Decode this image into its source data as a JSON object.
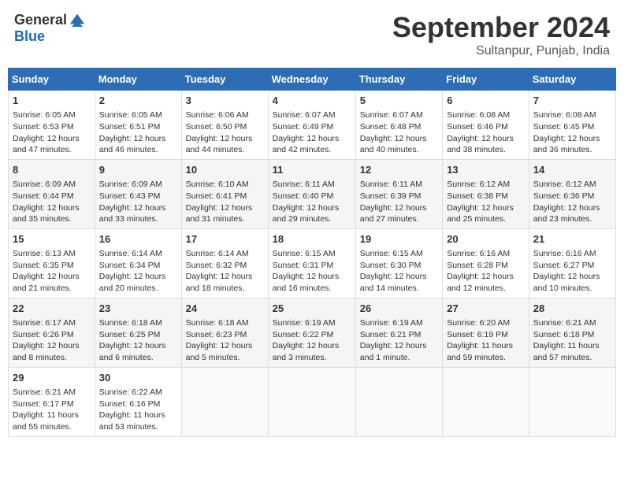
{
  "header": {
    "logo_general": "General",
    "logo_blue": "Blue",
    "month_title": "September 2024",
    "location": "Sultanpur, Punjab, India"
  },
  "days_of_week": [
    "Sunday",
    "Monday",
    "Tuesday",
    "Wednesday",
    "Thursday",
    "Friday",
    "Saturday"
  ],
  "weeks": [
    [
      {
        "day": 1,
        "sunrise": "6:05 AM",
        "sunset": "6:53 PM",
        "daylight": "12 hours and 47 minutes."
      },
      {
        "day": 2,
        "sunrise": "6:05 AM",
        "sunset": "6:51 PM",
        "daylight": "12 hours and 46 minutes."
      },
      {
        "day": 3,
        "sunrise": "6:06 AM",
        "sunset": "6:50 PM",
        "daylight": "12 hours and 44 minutes."
      },
      {
        "day": 4,
        "sunrise": "6:07 AM",
        "sunset": "6:49 PM",
        "daylight": "12 hours and 42 minutes."
      },
      {
        "day": 5,
        "sunrise": "6:07 AM",
        "sunset": "6:48 PM",
        "daylight": "12 hours and 40 minutes."
      },
      {
        "day": 6,
        "sunrise": "6:08 AM",
        "sunset": "6:46 PM",
        "daylight": "12 hours and 38 minutes."
      },
      {
        "day": 7,
        "sunrise": "6:08 AM",
        "sunset": "6:45 PM",
        "daylight": "12 hours and 36 minutes."
      }
    ],
    [
      {
        "day": 8,
        "sunrise": "6:09 AM",
        "sunset": "6:44 PM",
        "daylight": "12 hours and 35 minutes."
      },
      {
        "day": 9,
        "sunrise": "6:09 AM",
        "sunset": "6:43 PM",
        "daylight": "12 hours and 33 minutes."
      },
      {
        "day": 10,
        "sunrise": "6:10 AM",
        "sunset": "6:41 PM",
        "daylight": "12 hours and 31 minutes."
      },
      {
        "day": 11,
        "sunrise": "6:11 AM",
        "sunset": "6:40 PM",
        "daylight": "12 hours and 29 minutes."
      },
      {
        "day": 12,
        "sunrise": "6:11 AM",
        "sunset": "6:39 PM",
        "daylight": "12 hours and 27 minutes."
      },
      {
        "day": 13,
        "sunrise": "6:12 AM",
        "sunset": "6:38 PM",
        "daylight": "12 hours and 25 minutes."
      },
      {
        "day": 14,
        "sunrise": "6:12 AM",
        "sunset": "6:36 PM",
        "daylight": "12 hours and 23 minutes."
      }
    ],
    [
      {
        "day": 15,
        "sunrise": "6:13 AM",
        "sunset": "6:35 PM",
        "daylight": "12 hours and 21 minutes."
      },
      {
        "day": 16,
        "sunrise": "6:14 AM",
        "sunset": "6:34 PM",
        "daylight": "12 hours and 20 minutes."
      },
      {
        "day": 17,
        "sunrise": "6:14 AM",
        "sunset": "6:32 PM",
        "daylight": "12 hours and 18 minutes."
      },
      {
        "day": 18,
        "sunrise": "6:15 AM",
        "sunset": "6:31 PM",
        "daylight": "12 hours and 16 minutes."
      },
      {
        "day": 19,
        "sunrise": "6:15 AM",
        "sunset": "6:30 PM",
        "daylight": "12 hours and 14 minutes."
      },
      {
        "day": 20,
        "sunrise": "6:16 AM",
        "sunset": "6:28 PM",
        "daylight": "12 hours and 12 minutes."
      },
      {
        "day": 21,
        "sunrise": "6:16 AM",
        "sunset": "6:27 PM",
        "daylight": "12 hours and 10 minutes."
      }
    ],
    [
      {
        "day": 22,
        "sunrise": "6:17 AM",
        "sunset": "6:26 PM",
        "daylight": "12 hours and 8 minutes."
      },
      {
        "day": 23,
        "sunrise": "6:18 AM",
        "sunset": "6:25 PM",
        "daylight": "12 hours and 6 minutes."
      },
      {
        "day": 24,
        "sunrise": "6:18 AM",
        "sunset": "6:23 PM",
        "daylight": "12 hours and 5 minutes."
      },
      {
        "day": 25,
        "sunrise": "6:19 AM",
        "sunset": "6:22 PM",
        "daylight": "12 hours and 3 minutes."
      },
      {
        "day": 26,
        "sunrise": "6:19 AM",
        "sunset": "6:21 PM",
        "daylight": "12 hours and 1 minute."
      },
      {
        "day": 27,
        "sunrise": "6:20 AM",
        "sunset": "6:19 PM",
        "daylight": "11 hours and 59 minutes."
      },
      {
        "day": 28,
        "sunrise": "6:21 AM",
        "sunset": "6:18 PM",
        "daylight": "11 hours and 57 minutes."
      }
    ],
    [
      {
        "day": 29,
        "sunrise": "6:21 AM",
        "sunset": "6:17 PM",
        "daylight": "11 hours and 55 minutes."
      },
      {
        "day": 30,
        "sunrise": "6:22 AM",
        "sunset": "6:16 PM",
        "daylight": "11 hours and 53 minutes."
      },
      null,
      null,
      null,
      null,
      null
    ]
  ]
}
